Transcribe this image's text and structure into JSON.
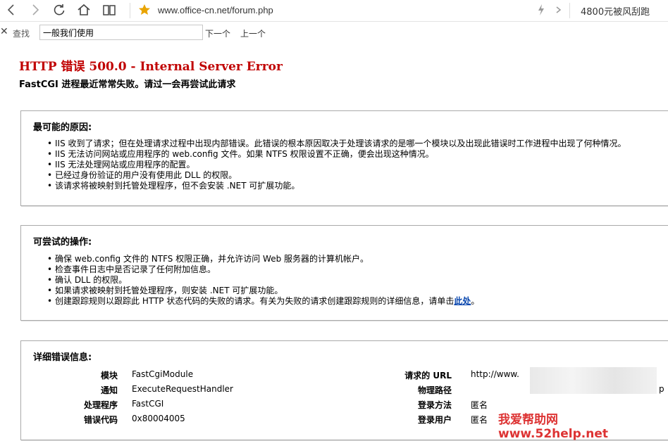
{
  "browser": {
    "url": "www.office-cn.net/forum.php",
    "right_text": "4800元被风刮跑"
  },
  "findbar": {
    "label": "查找",
    "query": "一般我们使用",
    "next": "下一个",
    "prev": "上一个"
  },
  "error": {
    "title": "HTTP 错误 500.0 - Internal Server Error",
    "subtitle": "FastCGI 进程最近常常失败。请过一会再尝试此请求"
  },
  "causes": {
    "heading": "最可能的原因:",
    "items": [
      "IIS 收到了请求；但在处理请求过程中出现内部错误。此错误的根本原因取决于处理该请求的是哪一个模块以及出现此错误时工作进程中出现了何种情况。",
      "IIS 无法访问网站或应用程序的 web.config 文件。如果 NTFS 权限设置不正确，便会出现这种情况。",
      "IIS 无法处理网站或应用程序的配置。",
      "已经过身份验证的用户没有使用此 DLL 的权限。",
      "该请求将被映射到托管处理程序，但不会安装 .NET 可扩展功能。"
    ]
  },
  "actions": {
    "heading": "可尝试的操作:",
    "items": [
      "确保 web.config 文件的 NTFS 权限正确，并允许访问 Web 服务器的计算机帐户。",
      "检查事件日志中是否记录了任何附加信息。",
      "确认 DLL 的权限。",
      "如果请求被映射到托管处理程序，则安装 .NET 可扩展功能。"
    ],
    "last_item": "创建跟踪规则以跟踪此 HTTP 状态代码的失败的请求。有关为失败的请求创建跟踪规则的详细信息，请单击",
    "link": "此处",
    "last_suffix": "。"
  },
  "details": {
    "heading": "详细错误信息:",
    "left": [
      {
        "label": "模块",
        "value": "FastCgiModule"
      },
      {
        "label": "通知",
        "value": "ExecuteRequestHandler"
      },
      {
        "label": "处理程序",
        "value": "FastCGI"
      },
      {
        "label": "错误代码",
        "value": "0x80004005"
      }
    ],
    "right": [
      {
        "label": "请求的 URL",
        "value": "http://www."
      },
      {
        "label": "物理路径",
        "value": "p"
      },
      {
        "label": "登录方法",
        "value": "匿名"
      },
      {
        "label": "登录用户",
        "value": "匿名"
      }
    ]
  },
  "watermark": "我爱帮助网 www.52help.net"
}
